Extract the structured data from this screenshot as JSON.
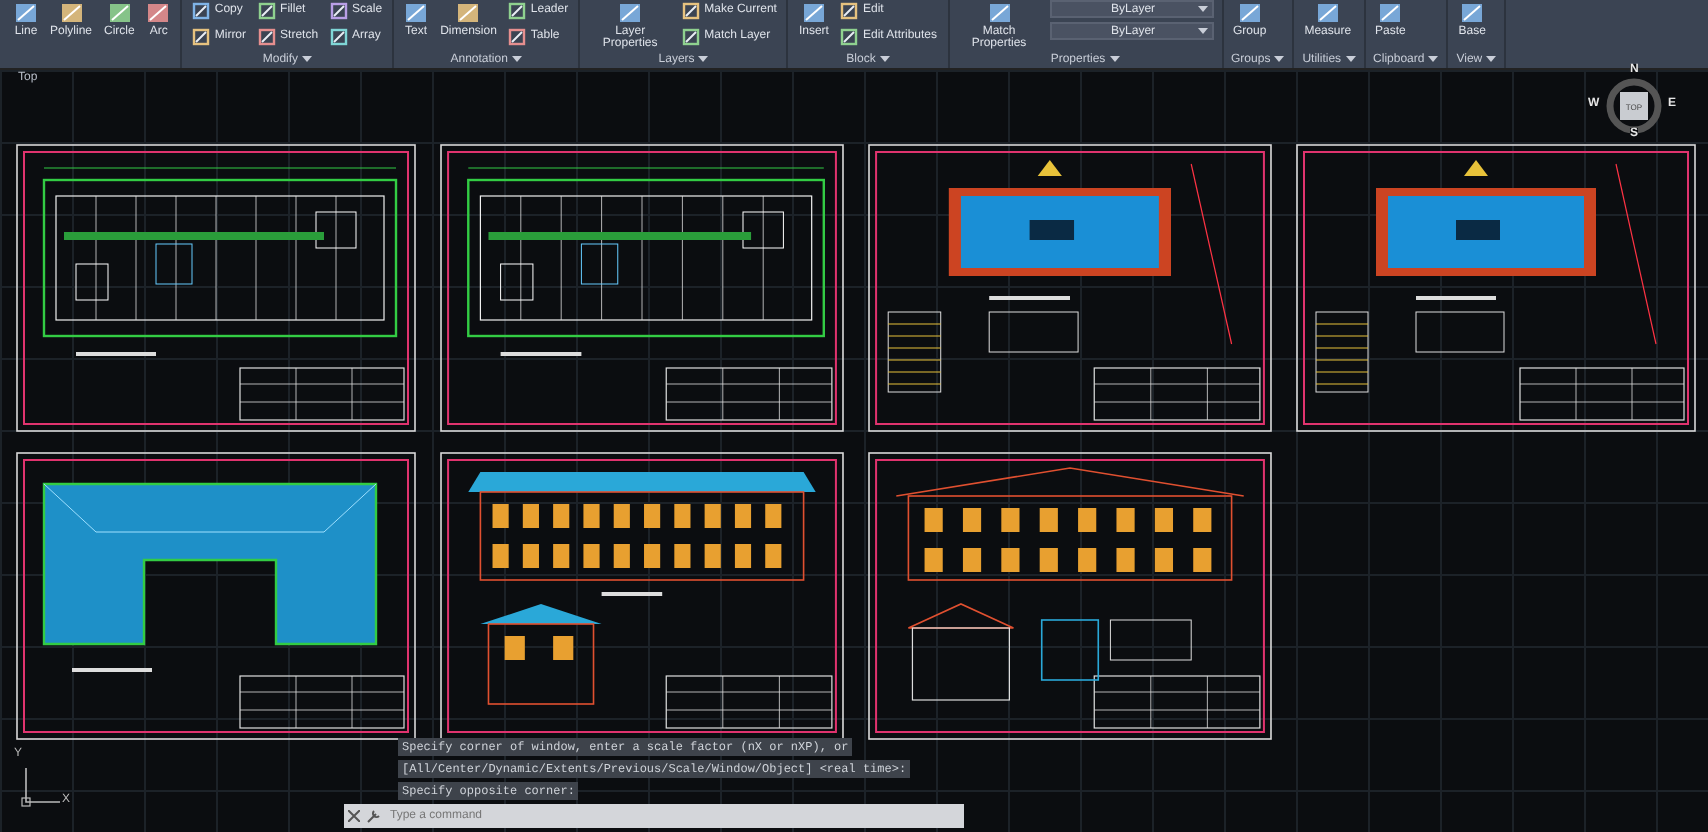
{
  "ribbon": {
    "panels": [
      {
        "tools": [
          {
            "kind": "large",
            "label": "Line"
          },
          {
            "kind": "large",
            "label": "Polyline"
          },
          {
            "kind": "large",
            "label": "Circle"
          },
          {
            "kind": "large",
            "label": "Arc"
          }
        ]
      },
      {
        "title": "Modify",
        "tools": [
          {
            "kind": "small",
            "label": "Copy"
          },
          {
            "kind": "small",
            "label": "Mirror"
          },
          {
            "kind": "small",
            "label": "Fillet"
          },
          {
            "kind": "small",
            "label": "Stretch"
          },
          {
            "kind": "small",
            "label": "Scale"
          },
          {
            "kind": "small",
            "label": "Array"
          }
        ]
      },
      {
        "title": "Annotation",
        "tools": [
          {
            "kind": "large",
            "label": "Text"
          },
          {
            "kind": "large",
            "label": "Dimension"
          },
          {
            "kind": "small",
            "label": "Leader"
          },
          {
            "kind": "small",
            "label": "Table"
          }
        ]
      },
      {
        "title": "Layers",
        "tools": [
          {
            "kind": "large",
            "label": "Layer Properties"
          },
          {
            "kind": "small",
            "label": "Make Current"
          },
          {
            "kind": "small",
            "label": "Match Layer"
          }
        ]
      },
      {
        "title": "Block",
        "tools": [
          {
            "kind": "large",
            "label": "Insert"
          },
          {
            "kind": "small",
            "label": "Edit"
          },
          {
            "kind": "small",
            "label": "Edit Attributes"
          }
        ]
      },
      {
        "title": "Properties",
        "tools": [
          {
            "kind": "large",
            "label": "Match Properties"
          },
          {
            "kind": "dropdown",
            "label": "ByLayer"
          },
          {
            "kind": "dropdown",
            "label": "ByLayer"
          }
        ]
      },
      {
        "title": "Groups",
        "tools": [
          {
            "kind": "large",
            "label": "Group"
          }
        ]
      },
      {
        "title": "Utilities",
        "tools": [
          {
            "kind": "large",
            "label": "Measure"
          }
        ]
      },
      {
        "title": "Clipboard",
        "tools": [
          {
            "kind": "large",
            "label": "Paste"
          }
        ]
      },
      {
        "title": "View",
        "tools": [
          {
            "kind": "large",
            "label": "Base"
          }
        ]
      }
    ]
  },
  "viewport": {
    "label": "Top"
  },
  "viewcube": {
    "top": "TOP",
    "north": "N",
    "south": "S",
    "west": "W",
    "east": "E"
  },
  "sheets": [
    {
      "kind": "floor-plan"
    },
    {
      "kind": "floor-plan"
    },
    {
      "kind": "site-plan"
    },
    {
      "kind": "site-plan"
    },
    {
      "kind": "roof-plan"
    },
    {
      "kind": "elevation"
    },
    {
      "kind": "section"
    }
  ],
  "ucs": {
    "x": "X",
    "y": "Y"
  },
  "command": {
    "history": [
      "Specify corner of window, enter a scale factor (nX or nXP), or",
      "[All/Center/Dynamic/Extents/Previous/Scale/Window/Object] <real time>:",
      "Specify opposite corner:"
    ],
    "placeholder": "Type a command"
  }
}
